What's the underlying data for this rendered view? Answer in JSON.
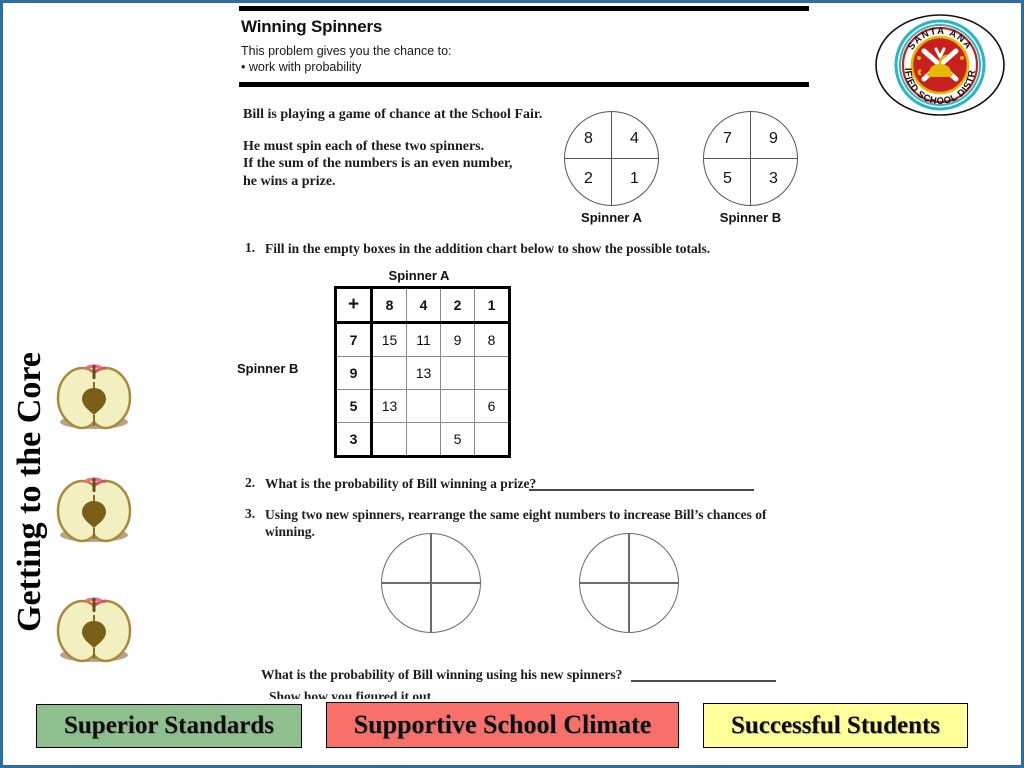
{
  "slide": {
    "border_color": "#2e6da4",
    "background": "#ffffff"
  },
  "left_rail": {
    "vertical_title": "Getting to the Core",
    "apple_icon_name": "apple-half-icon",
    "apple_count": 3
  },
  "worksheet": {
    "title": "Winning Spinners",
    "subtitle_line1": "This problem gives you the chance to:",
    "subtitle_line2": "• work with probability",
    "intro_line1": "Bill is playing a game of chance at the School Fair.",
    "intro_line2": "He must spin each of these two spinners.",
    "intro_line3": "If the sum of the numbers is an even number,",
    "intro_line4": "he wins a prize.",
    "spinner_a": {
      "label": "Spinner A",
      "top_left": "8",
      "top_right": "4",
      "bottom_left": "2",
      "bottom_right": "1"
    },
    "spinner_b": {
      "label": "Spinner B",
      "top_left": "7",
      "top_right": "9",
      "bottom_left": "5",
      "bottom_right": "3"
    },
    "q1": {
      "number": "1.",
      "text": "Fill in the empty boxes in the addition chart below to show the possible totals."
    },
    "chart": {
      "caption_top": "Spinner A",
      "caption_left": "Spinner B",
      "header": [
        "+",
        "8",
        "4",
        "2",
        "1"
      ],
      "rows": [
        [
          "7",
          "15",
          "11",
          "9",
          "8"
        ],
        [
          "9",
          "",
          "13",
          "",
          ""
        ],
        [
          "5",
          "13",
          "",
          "",
          "6"
        ],
        [
          "3",
          "",
          "",
          "5",
          ""
        ]
      ]
    },
    "q2": {
      "number": "2.",
      "text": "What is the probability of Bill winning a prize?",
      "answer_value": ""
    },
    "q3": {
      "number": "3.",
      "text_before": "Using two new spinners, rearrange the ",
      "text_bold": "same eight numbers",
      "text_after": " to increase Bill’s chances of winning."
    },
    "q4": {
      "text": "What is the probability of Bill winning using his new spinners?",
      "answer_value": ""
    },
    "q5": {
      "text": "Show how you figured it out."
    }
  },
  "seal": {
    "name": "santa-ana-unified-school-district-seal",
    "text_top": "SANTA  ANA",
    "text_bottom": "UNIFIED SCHOOL DISTRICT",
    "ring_color": "#2bb5c4",
    "center_color": "#c8201f",
    "lamp_color": "#e6b800"
  },
  "banners": [
    {
      "label": "Superior Standards",
      "color": "#8fbf8f"
    },
    {
      "label": "Supportive School Climate",
      "color": "#f9706a"
    },
    {
      "label": "Successful Students",
      "color": "#ffff99"
    }
  ]
}
